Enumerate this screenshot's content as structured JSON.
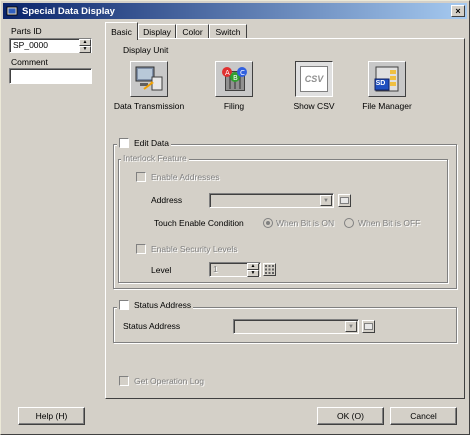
{
  "window": {
    "title": "Special Data Display",
    "close_glyph": "×"
  },
  "left": {
    "parts_id_label": "Parts ID",
    "parts_id_value": "SP_0000",
    "comment_label": "Comment",
    "comment_value": ""
  },
  "tabs": [
    "Basic",
    "Display",
    "Color",
    "Switch"
  ],
  "display_unit": {
    "label": "Display Unit",
    "items": [
      {
        "label": "Data Transmission",
        "icon": "data-transmission-icon"
      },
      {
        "label": "Filing",
        "icon": "filing-icon"
      },
      {
        "label": "Show CSV",
        "icon": "show-csv-icon",
        "icon_text": "CSV"
      },
      {
        "label": "File Manager",
        "icon": "file-manager-icon",
        "icon_text": "SD"
      }
    ]
  },
  "edit_data": {
    "label": "Edit Data",
    "interlock": {
      "label": "Interlock Feature",
      "enable_addresses": "Enable Addresses",
      "address_label": "Address",
      "address_value": "",
      "touch_label": "Touch Enable Condition",
      "radio_on": "When Bit is ON",
      "radio_off": "When Bit is OFF",
      "enable_security": "Enable Security Levels",
      "level_label": "Level",
      "level_value": "1"
    }
  },
  "status_address": {
    "label": "Status Address",
    "field_label": "Status Address",
    "field_value": ""
  },
  "get_operation_log": "Get Operation Log",
  "buttons": {
    "help": "Help (H)",
    "ok": "OK (O)",
    "cancel": "Cancel"
  },
  "colors": {
    "face": "#d4d0c8",
    "title_start": "#0a246a",
    "title_end": "#a6caf0"
  }
}
